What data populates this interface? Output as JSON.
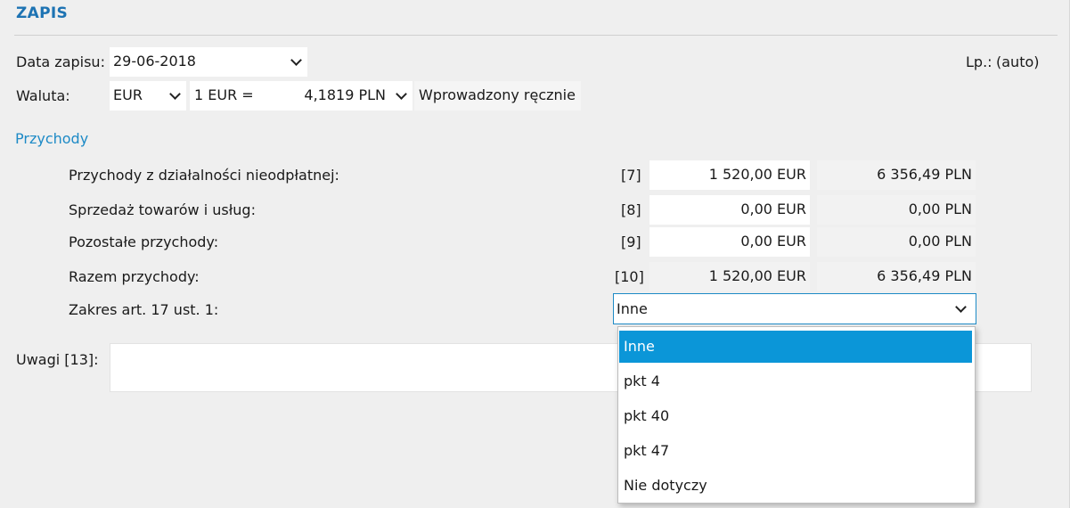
{
  "header": {
    "title": "ZAPIS"
  },
  "date_row": {
    "label": "Data zapisu:",
    "value": "29-06-2018"
  },
  "lp": {
    "label": "Lp.:",
    "value": "(auto)"
  },
  "currency_row": {
    "label": "Waluta:",
    "currency": "EUR",
    "rate_prefix": "1 EUR =",
    "rate_value": "4,1819 PLN",
    "rate_mode": "Wprowadzony ręcznie"
  },
  "section": {
    "title": "Przychody"
  },
  "rows": [
    {
      "label": "Przychody z działalności nieodpłatnej:",
      "code": "[7]",
      "eur": "1 520,00 EUR",
      "pln": "6 356,49 PLN"
    },
    {
      "label": "Sprzedaż towarów i usług:",
      "code": "[8]",
      "eur": "0,00 EUR",
      "pln": "0,00 PLN"
    },
    {
      "label": "Pozostałe przychody:",
      "code": "[9]",
      "eur": "0,00 EUR",
      "pln": "0,00 PLN"
    },
    {
      "label": "Razem przychody:",
      "code": "[10]",
      "eur": "1 520,00 EUR",
      "pln": "6 356,49 PLN"
    }
  ],
  "zakres": {
    "label": "Zakres art. 17 ust. 1:",
    "selected": "Inne",
    "options": [
      "Inne",
      "pkt 4",
      "pkt 40",
      "pkt 47",
      "Nie dotyczy"
    ]
  },
  "uwagi": {
    "label": "Uwagi [13]:",
    "value": ""
  },
  "colors": {
    "accent": "#1d73b3",
    "section": "#1d8ac6",
    "selection": "#0b96d8"
  }
}
